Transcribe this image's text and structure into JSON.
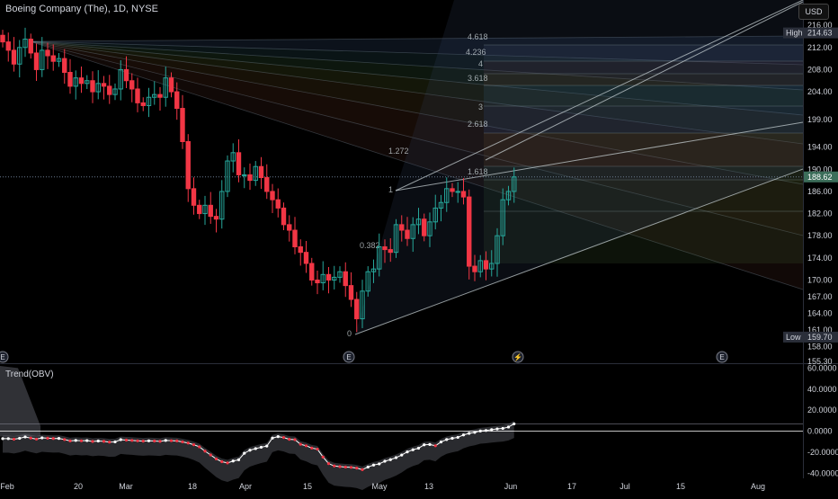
{
  "header": {
    "title": "Boeing Company (The), 1D, NYSE"
  },
  "currency_button": "USD",
  "indicator": {
    "title": "Trend(OBV)"
  },
  "colors": {
    "up": "#26a69a",
    "down": "#f23645",
    "bg": "#000000",
    "grid": "#1e222d",
    "axis_text": "#d1d4dc",
    "obv_line": "#ffffff",
    "obv_dot_up": "#ffffff",
    "obv_dot_down": "#f23645"
  },
  "price_labels": {
    "high": {
      "text": "High",
      "value": "214.63"
    },
    "low": {
      "text": "Low",
      "value": "159.70"
    },
    "current": "188.62"
  },
  "event_markers": [
    "E",
    "E",
    "lightning",
    "E"
  ],
  "fib_levels": [
    "4.618",
    "4.236",
    "4",
    "3.618",
    "3",
    "2.618",
    "1.618",
    "1.272",
    "1",
    "0.382",
    "0"
  ],
  "chart_data": [
    {
      "type": "candlestick",
      "title": "Boeing Company (The), 1D, NYSE",
      "y_ticks": [
        216.0,
        212.0,
        208.0,
        204.0,
        199.0,
        194.0,
        190.0,
        186.0,
        182.0,
        178.0,
        174.0,
        170.0,
        167.0,
        164.0,
        161.0,
        158.0,
        155.3
      ],
      "x_ticks": [
        "Feb",
        "20",
        "Mar",
        "18",
        "Apr",
        "15",
        "May",
        "13",
        "Jun",
        "17",
        "Jul",
        "15",
        "Aug"
      ],
      "close": [
        213.0,
        211.5,
        209.0,
        212.0,
        213.5,
        211.0,
        208.0,
        211.5,
        210.5,
        209.5,
        210.0,
        207.5,
        205.0,
        206.5,
        205.5,
        206.0,
        204.0,
        205.5,
        205.0,
        203.5,
        204.5,
        208.0,
        206.0,
        204.5,
        202.0,
        201.5,
        203.0,
        203.5,
        203.0,
        206.5,
        204.0,
        201.0,
        195.0,
        186.5,
        183.5,
        182.0,
        183.5,
        181.5,
        181.0,
        186.0,
        191.5,
        193.0,
        189.0,
        189.0,
        188.0,
        190.5,
        188.5,
        186.0,
        184.5,
        183.0,
        180.0,
        179.0,
        176.0,
        175.0,
        173.0,
        170.0,
        169.5,
        171.0,
        170.0,
        170.5,
        171.5,
        169.0,
        166.5,
        163.0,
        168.0,
        171.5,
        172.0,
        176.0,
        175.5,
        175.0,
        180.0,
        179.0,
        177.5,
        180.0,
        181.0,
        178.0,
        180.5,
        183.0,
        184.0,
        186.5,
        186.0,
        186.0,
        185.0,
        172.5,
        171.5,
        173.5,
        172.0,
        173.0,
        178.0,
        184.5,
        186.0,
        188.62
      ],
      "high": 214.63,
      "low": 159.7,
      "current": 188.62,
      "y_range": [
        155.3,
        217.0
      ]
    },
    {
      "type": "line",
      "title": "Trend(OBV)",
      "y_ticks": [
        60.0,
        40.0,
        20.0,
        0.0,
        -20.0,
        -40.0
      ],
      "values": [
        -7.0,
        -7.0,
        -7.6,
        -6.7,
        -5.4,
        -6.5,
        -7.5,
        -6.3,
        -6.6,
        -6.9,
        -6.8,
        -7.9,
        -9.2,
        -8.7,
        -9.1,
        -8.9,
        -9.7,
        -9.3,
        -9.6,
        -10.3,
        -10.1,
        -8.0,
        -8.4,
        -8.7,
        -9.1,
        -9.4,
        -9.1,
        -9.3,
        -9.6,
        -8.7,
        -9.0,
        -9.2,
        -10.1,
        -11.2,
        -12.8,
        -14.8,
        -18.9,
        -22.5,
        -26.3,
        -28.9,
        -30.1,
        -28.3,
        -27.1,
        -20.9,
        -18.0,
        -16.5,
        -15.2,
        -14.1,
        -6.5,
        -5.1,
        -6.0,
        -7.7,
        -8.0,
        -12.4,
        -13.8,
        -16.0,
        -17.0,
        -24.5,
        -30.7,
        -33.0,
        -33.6,
        -34.0,
        -34.3,
        -35.0,
        -36.5,
        -34.0,
        -32.1,
        -31.0,
        -28.5,
        -27.0,
        -25.1,
        -22.6,
        -19.6,
        -17.6,
        -16.1,
        -12.9,
        -12.6,
        -13.8,
        -10.2,
        -7.9,
        -6.7,
        -5.8,
        -3.5,
        -2.0,
        -1.1,
        0.2,
        0.7,
        1.5,
        2.2,
        2.7,
        4.0,
        7.0
      ],
      "y_range": [
        -43.0,
        62.0
      ]
    }
  ]
}
